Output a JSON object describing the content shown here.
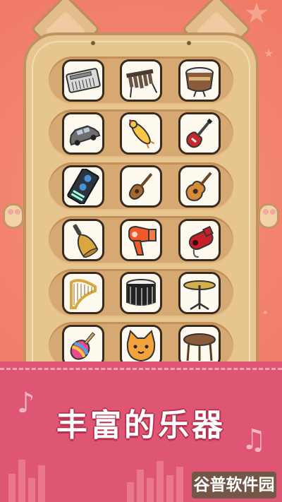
{
  "title": "丰富的乐器",
  "watermark": "谷普软件园",
  "colors": {
    "background": "#f3846f",
    "cabinet": "#e7c58f",
    "shelf": "#d6a972",
    "banner": "#df5574",
    "title_text": "#ffffff"
  },
  "instruments": [
    [
      "electronic-keyboard",
      "xylophone",
      "drum"
    ],
    [
      "car",
      "rubber-chicken",
      "electric-guitar"
    ],
    [
      "dj-mixer",
      "ukulele",
      "acoustic-guitar"
    ],
    [
      "hand-bell",
      "hair-dryer",
      "whistle"
    ],
    [
      "harp",
      "snare-drum",
      "cymbal"
    ],
    [
      "maraca",
      "cat-face",
      "round-table"
    ]
  ]
}
